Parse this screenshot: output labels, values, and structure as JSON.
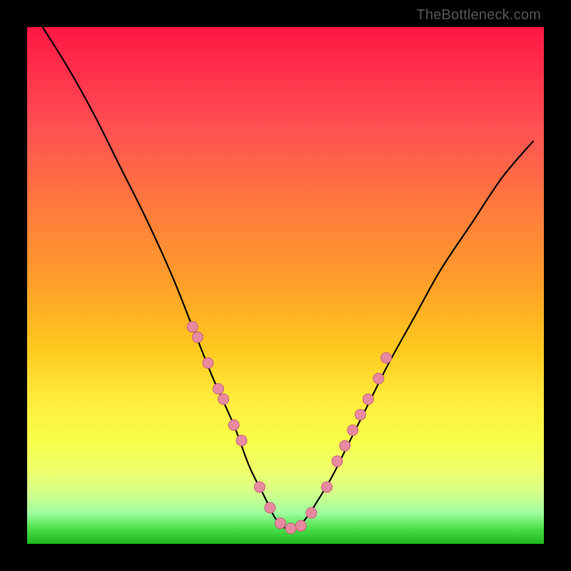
{
  "watermark": "TheBottleneck.com",
  "chart_data": {
    "type": "line",
    "title": "",
    "xlabel": "",
    "ylabel": "",
    "xlim": [
      0,
      100
    ],
    "ylim": [
      0,
      100
    ],
    "series": [
      {
        "name": "curve",
        "x": [
          3,
          8,
          13,
          18,
          23,
          28,
          32,
          36,
          40,
          43,
          46,
          48,
          50,
          52,
          54,
          56,
          59,
          62,
          66,
          70,
          75,
          80,
          86,
          92,
          98
        ],
        "values": [
          100,
          92,
          83,
          73,
          63,
          52,
          42,
          32,
          23,
          15,
          9,
          5,
          3,
          3,
          5,
          8,
          13,
          19,
          27,
          35,
          44,
          53,
          62,
          71,
          78
        ]
      }
    ],
    "markers": {
      "name": "dots",
      "color": "#e78aa0",
      "x": [
        32,
        33,
        35,
        37,
        38,
        40,
        41.5,
        45,
        47,
        49,
        51,
        53,
        55,
        58,
        60,
        61.5,
        63,
        64.5,
        66,
        68,
        69.5
      ],
      "values": [
        42,
        40,
        35,
        30,
        28,
        23,
        20,
        11,
        7,
        4,
        3,
        3.5,
        6,
        11,
        16,
        19,
        22,
        25,
        28,
        32,
        36
      ]
    },
    "colors": {
      "gradient_top": "#ff1744",
      "gradient_bottom": "#1eb81e",
      "curve": "#000000",
      "marker_fill": "#e78aa0",
      "marker_stroke": "#c7607a"
    }
  }
}
